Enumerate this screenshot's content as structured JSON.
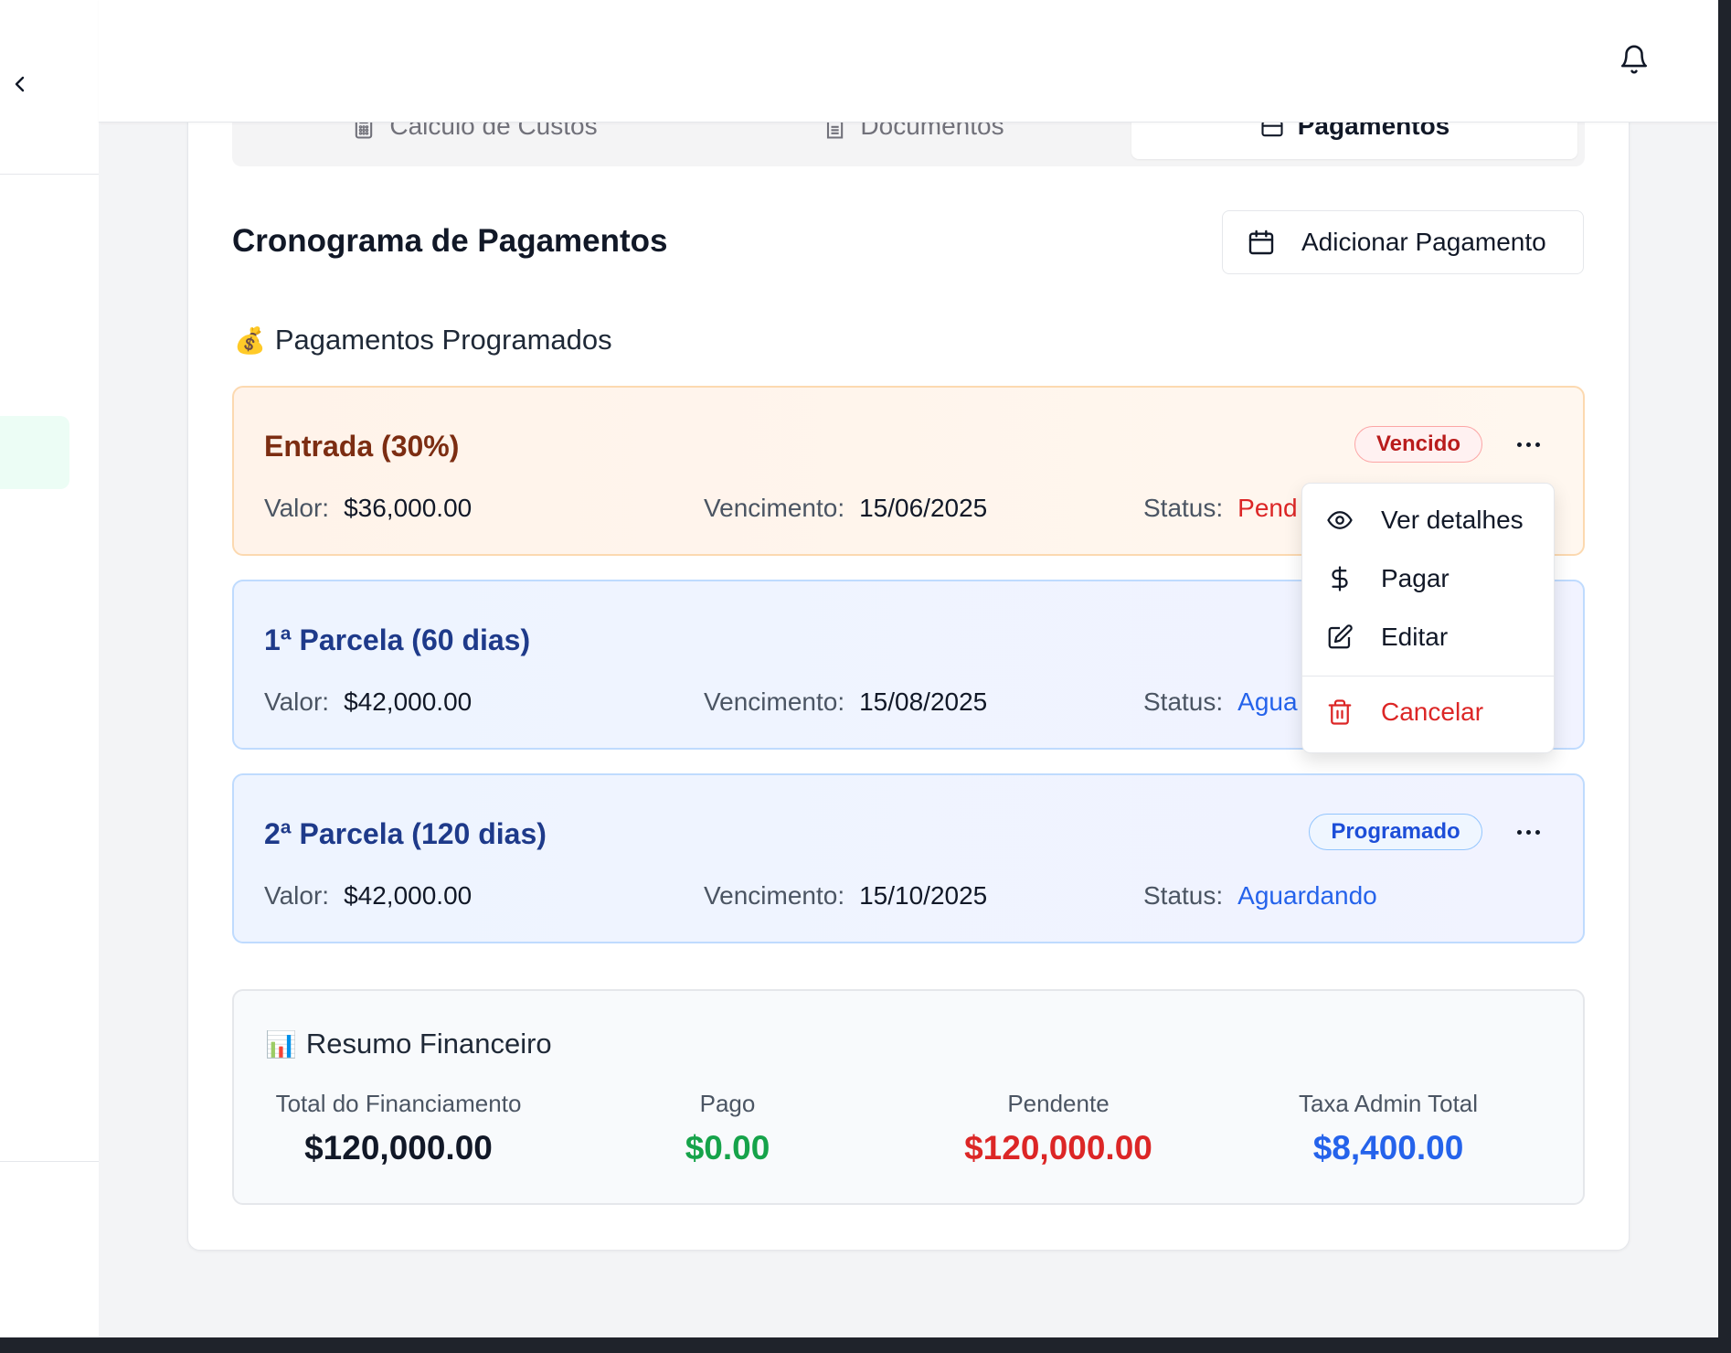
{
  "tabs": [
    {
      "label": "Calculo de Custos",
      "icon": "calculator-icon"
    },
    {
      "label": "Documentos",
      "icon": "document-icon"
    },
    {
      "label": "Pagamentos",
      "icon": "credit-card-icon",
      "active": true
    }
  ],
  "section": {
    "title": "Cronograma de Pagamentos",
    "add_button": "Adicionar Pagamento",
    "subsection_emoji": "💰",
    "subsection_title": "Pagamentos Programados"
  },
  "labels": {
    "valor": "Valor:",
    "vencimento": "Vencimento:",
    "status": "Status:"
  },
  "payments": [
    {
      "title": "Entrada (30%)",
      "badge": "Vencido",
      "valor": "$36,000.00",
      "vencimento": "15/06/2025",
      "status": "Pend",
      "color": "#dc2626"
    },
    {
      "title": "1ª Parcela (60 dias)",
      "valor": "$42,000.00",
      "vencimento": "15/08/2025",
      "status": "Agua",
      "color": "#2563eb"
    },
    {
      "title": "2ª Parcela (120 dias)",
      "badge": "Programado",
      "valor": "$42,000.00",
      "vencimento": "15/10/2025",
      "status": "Aguardando",
      "color": "#2563eb"
    }
  ],
  "menu": {
    "view": "Ver detalhes",
    "pay": "Pagar",
    "edit": "Editar",
    "cancel": "Cancelar"
  },
  "summary": {
    "emoji": "📊",
    "title": "Resumo Financeiro",
    "items": [
      {
        "label": "Total do Financiamento",
        "value": "$120,000.00",
        "color": "#111827"
      },
      {
        "label": "Pago",
        "value": "$0.00",
        "color": "#16a34a"
      },
      {
        "label": "Pendente",
        "value": "$120,000.00",
        "color": "#dc2626"
      },
      {
        "label": "Taxa Admin Total",
        "value": "$8,400.00",
        "color": "#2563eb"
      }
    ]
  }
}
